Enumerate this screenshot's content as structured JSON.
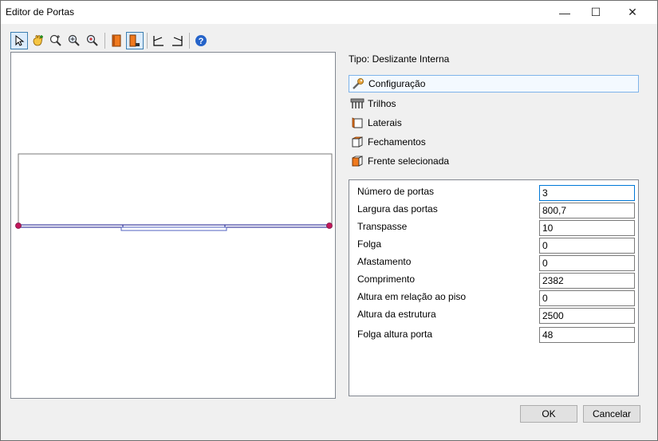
{
  "window": {
    "title": "Editor de Portas",
    "minimize_glyph": "—",
    "maximize_glyph": "☐",
    "close_glyph": "✕"
  },
  "toolbar": {
    "buttons": [
      {
        "icon": "pointer-icon",
        "active": true
      },
      {
        "icon": "pan-icon"
      },
      {
        "icon": "zoom-window-icon"
      },
      {
        "icon": "zoom-in-icon"
      },
      {
        "icon": "zoom-out-icon"
      },
      {
        "icon": "door-front-icon"
      },
      {
        "icon": "door-side-icon",
        "active": true
      },
      {
        "icon": "view-left-icon"
      },
      {
        "icon": "view-right-icon"
      },
      {
        "icon": "help-icon"
      }
    ]
  },
  "tipo_label": "Tipo: Deslizante Interna",
  "sections": [
    {
      "label": "Configuração",
      "icon": "wrench-icon",
      "selected": true
    },
    {
      "label": "Trilhos",
      "icon": "rails-icon"
    },
    {
      "label": "Laterais",
      "icon": "laterals-icon"
    },
    {
      "label": "Fechamentos",
      "icon": "closures-icon"
    },
    {
      "label": "Frente selecionada",
      "icon": "selected-front-icon"
    }
  ],
  "properties": [
    {
      "label": "Número de portas",
      "value": "3"
    },
    {
      "label": "Largura das portas",
      "value": "800,7"
    },
    {
      "label": "Transpasse",
      "value": "10"
    },
    {
      "label": "Folga",
      "value": "0"
    },
    {
      "label": "Afastamento",
      "value": "0"
    },
    {
      "label": "Comprimento",
      "value": "2382"
    },
    {
      "label": "Altura em relação ao piso",
      "value": "0"
    },
    {
      "label": "Altura da estrutura",
      "value": "2500"
    },
    {
      "label": "Folga altura porta",
      "value": "48"
    }
  ],
  "buttons": {
    "ok": "OK",
    "cancel": "Cancelar"
  },
  "colors": {
    "accent": "#0078d7",
    "door_line": "#1a1a8c",
    "door_orange": "#f07a1e",
    "marker": "#c2185b"
  }
}
